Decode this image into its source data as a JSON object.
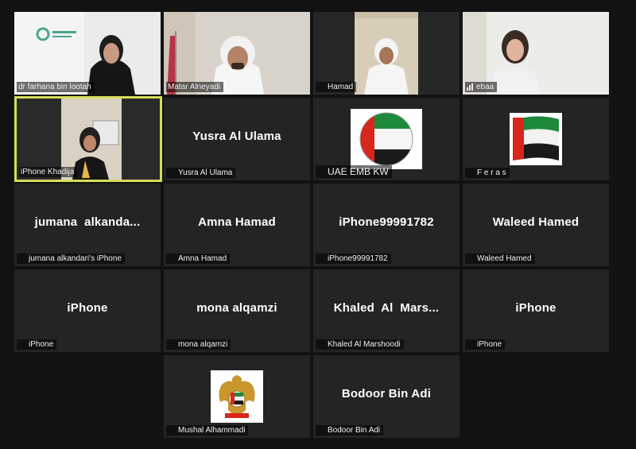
{
  "meeting": {
    "tiles": [
      {
        "name": "dr farhana bin lootah",
        "center": "",
        "muted": false,
        "video": true
      },
      {
        "name": "Matar Alneyadi",
        "center": "",
        "muted": false,
        "video": true
      },
      {
        "name": "Hamad",
        "center": "",
        "muted": true,
        "video": true
      },
      {
        "name": "ebaa",
        "center": "",
        "muted": false,
        "speaking": true,
        "video": true
      },
      {
        "name": "iPhone Khadija",
        "center": "",
        "muted": false,
        "video": true,
        "active_speaker": true
      },
      {
        "name": "Yusra Al Ulama",
        "center": "Yusra Al Ulama",
        "muted": true
      },
      {
        "name": "UAE EMB KW",
        "center": "",
        "muted": true,
        "picture": "uae-flag-round"
      },
      {
        "name": "F e r a s",
        "center": "",
        "muted": true,
        "picture": "uae-flag-waving"
      },
      {
        "name": "jumana alkandari's iPhone",
        "center": "jumana  alkanda...",
        "muted": true
      },
      {
        "name": "Amna Hamad",
        "center": "Amna Hamad",
        "muted": true
      },
      {
        "name": "iPhone99991782",
        "center": "iPhone99991782",
        "muted": true
      },
      {
        "name": "Waleed Hamed",
        "center": "Waleed Hamed",
        "muted": true
      },
      {
        "name": "iPhone",
        "center": "iPhone",
        "muted": true
      },
      {
        "name": "mona alqamzi",
        "center": "mona alqamzi",
        "muted": true
      },
      {
        "name": "Khaled Al Marshoodi",
        "center": "Khaled  Al  Mars...",
        "muted": true
      },
      {
        "name": "iPhone",
        "center": "iPhone",
        "muted": true
      },
      {
        "name": "Mushal Alhammadi",
        "center": "",
        "muted": true,
        "picture": "uae-emblem"
      },
      {
        "name": "Bodoor Bin Adi",
        "center": "Bodoor Bin Adi",
        "muted": true
      }
    ]
  },
  "colors": {
    "background": "#121212",
    "tile": "#242424",
    "active_border": "#d6de5a",
    "muted_icon": "#e0303a",
    "flag_red": "#d8261c",
    "flag_green": "#1d8a3a"
  }
}
